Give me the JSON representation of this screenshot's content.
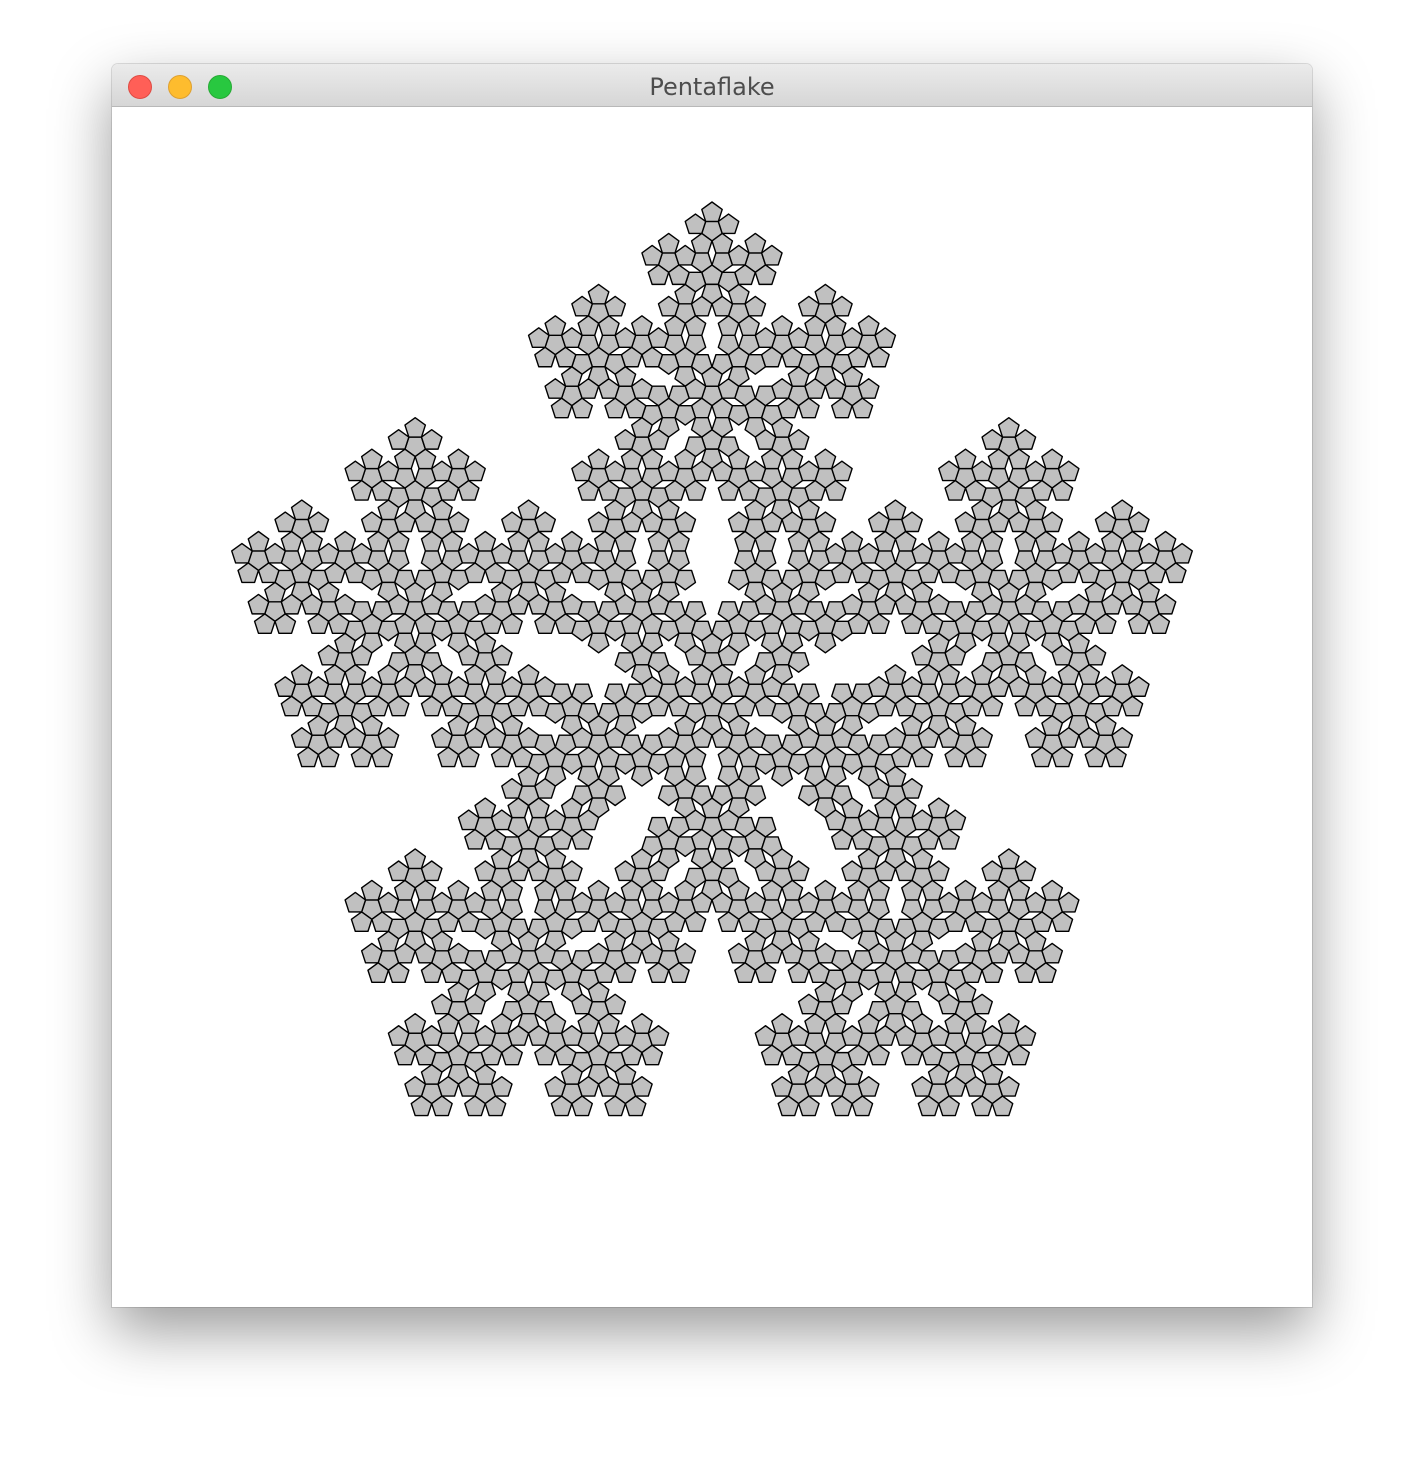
{
  "window": {
    "title": "Pentaflake",
    "controls": [
      {
        "name": "close-button",
        "color": "#ff5f57"
      },
      {
        "name": "minimize-button",
        "color": "#febc2e"
      },
      {
        "name": "zoom-button",
        "color": "#28c840"
      }
    ]
  },
  "fractal": {
    "shape": "pentaflake",
    "recursion_depth": 4,
    "fill_color": "#c0c0c0",
    "stroke_color": "#000000",
    "background_color": "#ffffff"
  }
}
